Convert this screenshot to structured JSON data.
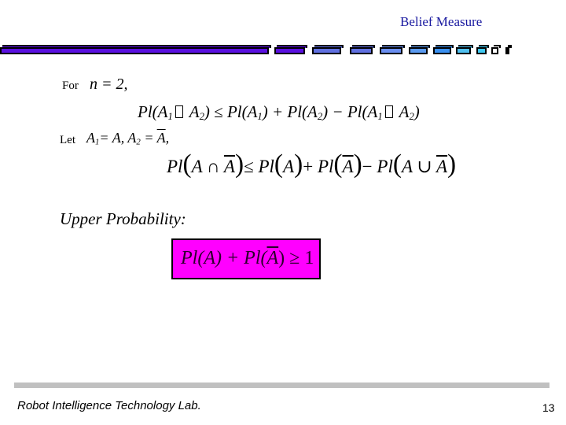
{
  "header": {
    "title": "Belief Measure",
    "title_color": "#1a1aa0",
    "bar_segments": [
      {
        "color": "#5a10e0"
      },
      {
        "color": "#5a10e0"
      },
      {
        "color": "#6070e0"
      },
      {
        "color": "#6070e0"
      },
      {
        "color": "#6a8ef0"
      },
      {
        "color": "#5a9af0"
      },
      {
        "color": "#3a90f0"
      },
      {
        "color": "#50c0f0"
      },
      {
        "color": "#40c8f0"
      },
      {
        "color": "#ffffff"
      },
      {
        "color": "#000000"
      }
    ]
  },
  "content": {
    "for_label": "For",
    "for_expr": "n = 2,",
    "eq1": {
      "lhs_pl": "Pl(",
      "a1": "A",
      "sub1": "1",
      "a2": "A",
      "sub2": "2",
      "close": ")",
      "rel": "≤",
      "rhs1": "Pl(A",
      "rhs1_sub": "1",
      "rhs1_close": ") + ",
      "rhs2": "Pl(A",
      "rhs2_sub": "2",
      "rhs2_close": ") − ",
      "rhs3": "Pl(A",
      "rhs3_sub": "1",
      "rhs3_a2": "A",
      "rhs3_sub2": "2",
      "rhs3_close": ")"
    },
    "let_label": "Let",
    "let_expr": {
      "a1": "A",
      "sub1": "1",
      "eq1": "= A,",
      "a2": "A",
      "sub2": "2",
      "eq2": "= ",
      "abar": "A",
      "trail": ","
    },
    "eq2": {
      "pl1": "Pl",
      "a": "A",
      "cap": "∩",
      "abar": "A",
      "rel": "≤",
      "pl2": "Pl",
      "a2": "A",
      "plus": "+",
      "pl3": "Pl",
      "abar2": "A",
      "minus": "−",
      "pl4": "Pl",
      "a3": "A",
      "cup": "∪",
      "abar3": "A"
    },
    "upper_probability_label": "Upper Probability:",
    "highlight": {
      "pl1": "Pl(A) + Pl(",
      "abar": "A",
      "tail": ") ≥ 1",
      "bg_color": "#ff00ff"
    }
  },
  "footer": {
    "lab_name": "Robot Intelligence Technology Lab.",
    "page_number": "13",
    "line_color": "#c0c0c0"
  }
}
